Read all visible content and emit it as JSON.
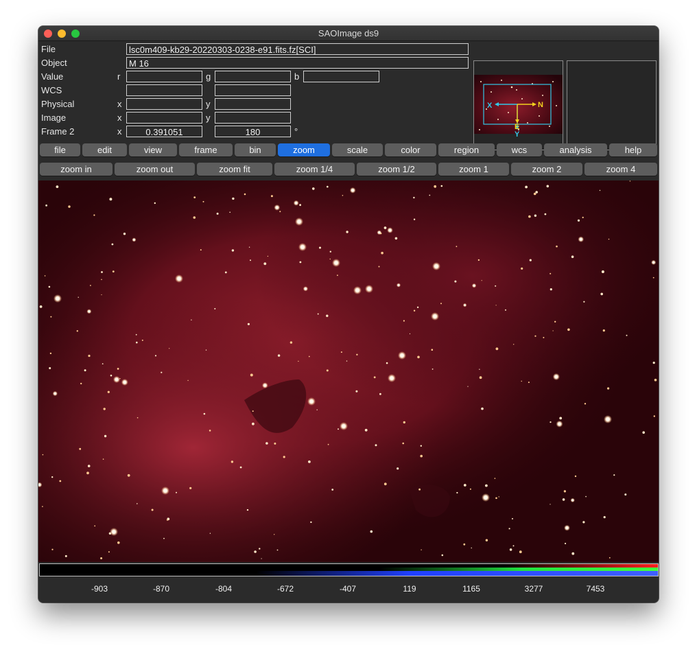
{
  "window": {
    "title": "SAOImage ds9"
  },
  "info": {
    "file_label": "File",
    "file_value": "lsc0m409-kb29-20220303-0238-e91.fits.fz[SCI]",
    "object_label": "Object",
    "object_value": "M 16",
    "value_label": "Value",
    "value_r_axis": "r",
    "value_g_axis": "g",
    "value_b_axis": "b",
    "value_r": "",
    "value_g": "",
    "value_b": "",
    "wcs_label": "WCS",
    "wcs_1": "",
    "wcs_2": "",
    "physical_label": "Physical",
    "physical_x_axis": "x",
    "physical_y_axis": "y",
    "physical_x": "",
    "physical_y": "",
    "image_label": "Image",
    "image_x_axis": "x",
    "image_y_axis": "y",
    "image_x": "",
    "image_y": "",
    "frame_label": "Frame 2",
    "frame_x_axis": "x",
    "frame_zoom": "0.391051",
    "frame_angle": "180",
    "frame_degree": "°"
  },
  "panner": {
    "x_label": "X",
    "y_label": "Y",
    "n_label": "N",
    "e_label": "E"
  },
  "menu": {
    "buttons": [
      "file",
      "edit",
      "view",
      "frame",
      "bin",
      "zoom",
      "scale",
      "color",
      "region",
      "wcs",
      "analysis",
      "help"
    ],
    "active": "zoom"
  },
  "zoom_bar": {
    "buttons": [
      "zoom in",
      "zoom out",
      "zoom fit",
      "zoom 1/4",
      "zoom 1/2",
      "zoom 1",
      "zoom 2",
      "zoom 4"
    ]
  },
  "colorbar": {
    "ticks": [
      "-903",
      "-870",
      "-804",
      "-672",
      "-407",
      "119",
      "1165",
      "3277",
      "7453"
    ]
  },
  "colors": {
    "accent": "#1f6fe0",
    "nebula": "#7a1420",
    "panner_box": "#32c8e6",
    "compass": "#f2d21e"
  }
}
